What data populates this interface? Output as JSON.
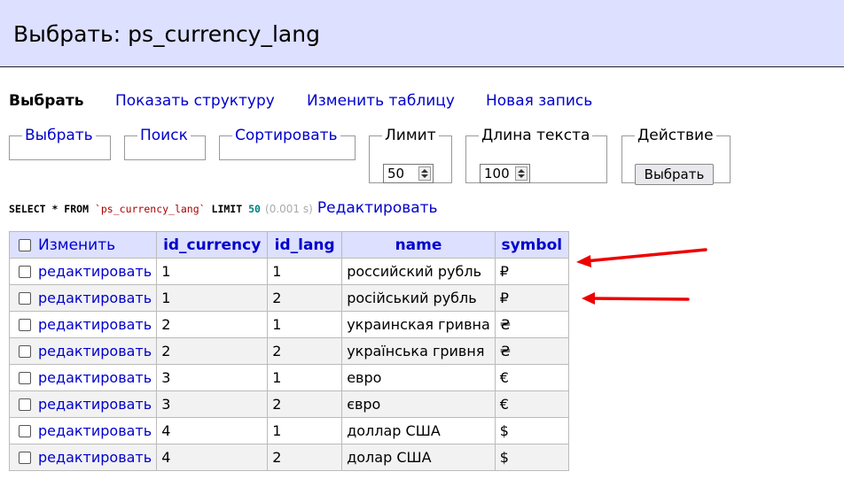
{
  "header": {
    "title": "Выбрать: ps_currency_lang"
  },
  "nav": {
    "active": "Выбрать",
    "links": [
      "Показать структуру",
      "Изменить таблицу",
      "Новая запись"
    ]
  },
  "filters": {
    "select_label": "Выбрать",
    "search_label": "Поиск",
    "sort_label": "Сортировать",
    "limit_label": "Лимит",
    "limit_value": "50",
    "text_length_label": "Длина текста",
    "text_length_value": "100",
    "action_label": "Действие",
    "action_button": "Выбрать"
  },
  "query": {
    "select_kw": "SELECT * FROM",
    "table": "`ps_currency_lang`",
    "limit_kw": "LIMIT",
    "limit_val": "50",
    "time": "(0.001 s)",
    "edit_link": "Редактировать"
  },
  "table": {
    "select_all_label": "Изменить",
    "columns": [
      "id_currency",
      "id_lang",
      "name",
      "symbol"
    ],
    "edit_label": "редактировать",
    "rows": [
      [
        "1",
        "1",
        "российский рубль",
        "₽"
      ],
      [
        "1",
        "2",
        "російський рубль",
        "₽"
      ],
      [
        "2",
        "1",
        "украинская гривна",
        "₴"
      ],
      [
        "2",
        "2",
        "українська гривня",
        "₴"
      ],
      [
        "3",
        "1",
        "евро",
        "€"
      ],
      [
        "3",
        "2",
        "євро",
        "€"
      ],
      [
        "4",
        "1",
        "доллар США",
        "$"
      ],
      [
        "4",
        "2",
        "долар США",
        "$"
      ]
    ]
  },
  "colors": {
    "header_bg": "#dde0ff",
    "link": "#0000cc",
    "arrow": "#ee0000"
  }
}
